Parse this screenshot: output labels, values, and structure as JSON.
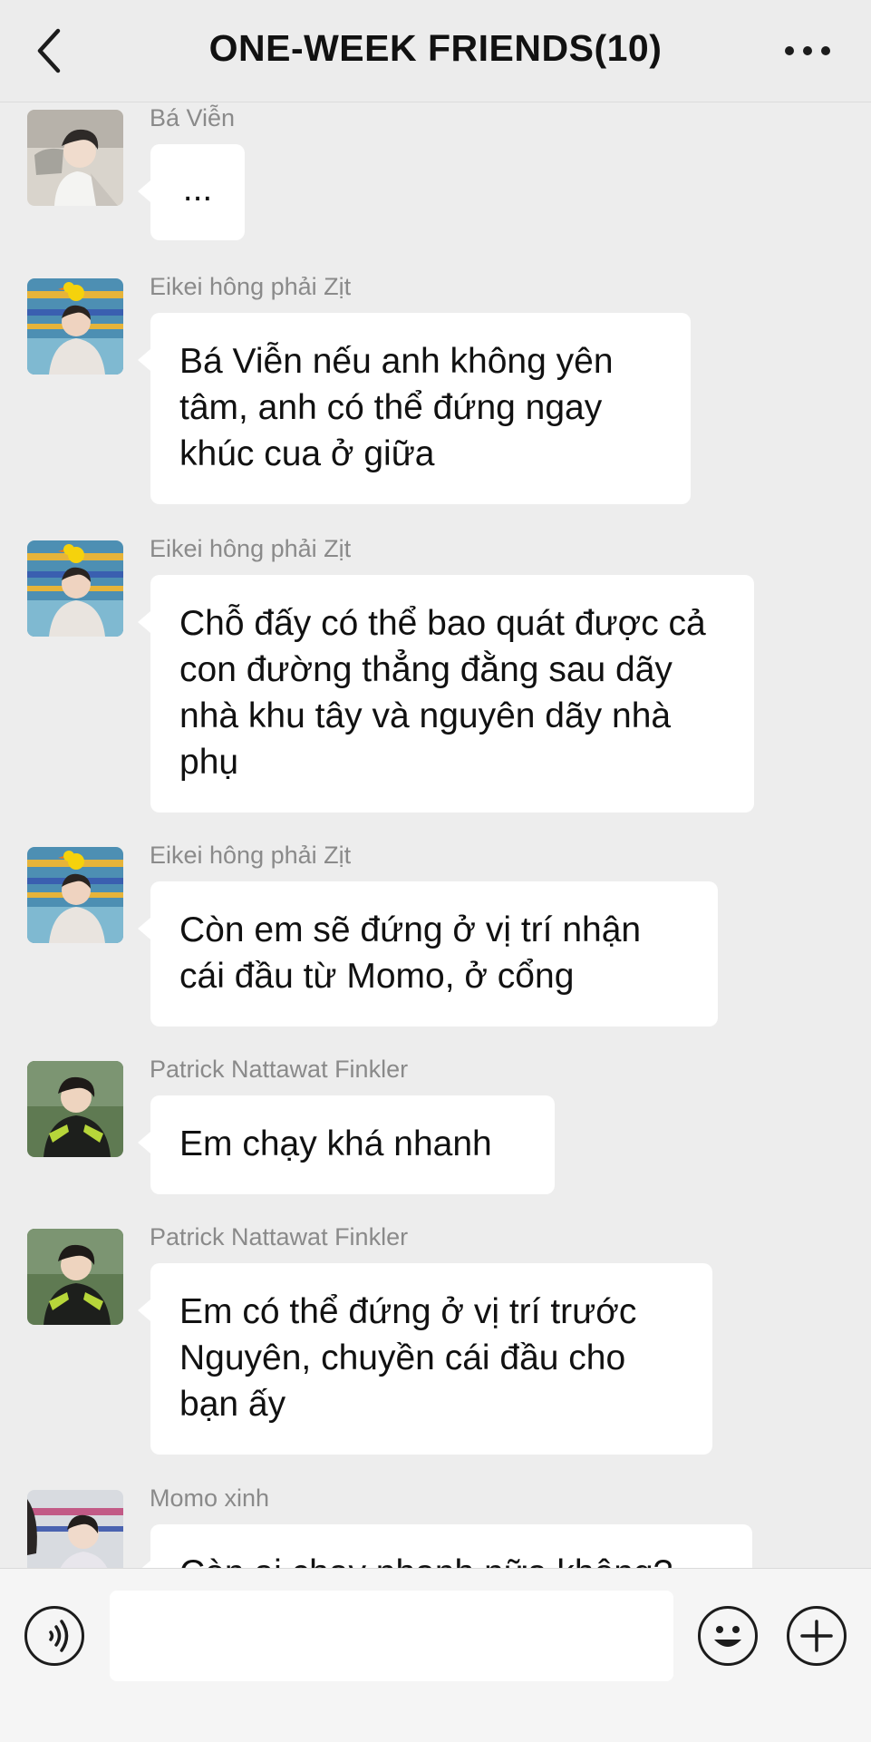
{
  "header": {
    "title": "ONE-WEEK FRIENDS(10)",
    "back_icon": "chevron-left-icon",
    "more_icon": "more-dots-icon"
  },
  "messages": [
    {
      "sender": "Bá Viễn",
      "text": "..."
    },
    {
      "sender": "Eikei hông phải Zịt",
      "text": "Bá Viễn nếu anh không yên tâm, anh có thể đứng ngay khúc cua ở giữa"
    },
    {
      "sender": "Eikei hông phải Zịt",
      "text": "Chỗ đấy có thể bao quát được cả con đường thẳng đằng sau dãy nhà khu tây và nguyên dãy nhà phụ"
    },
    {
      "sender": "Eikei hông phải Zịt",
      "text": "Còn em sẽ đứng ở vị trí nhận cái đầu từ Momo, ở cổng"
    },
    {
      "sender": "Patrick Nattawat Finkler",
      "text": "Em chạy khá nhanh"
    },
    {
      "sender": "Patrick Nattawat Finkler",
      "text": "Em có thể đứng ở vị trí trước Nguyên, chuyền cái đầu cho bạn ấy"
    },
    {
      "sender": "Momo xinh",
      "text": "Còn ai chạy nhanh nữa không?"
    }
  ],
  "input_bar": {
    "voice_icon": "voice-icon",
    "emoji_icon": "emoji-icon",
    "plus_icon": "plus-icon",
    "message_value": ""
  },
  "colors": {
    "background": "#ededed",
    "bubble": "#ffffff",
    "sender_name": "#8a8a8a"
  }
}
